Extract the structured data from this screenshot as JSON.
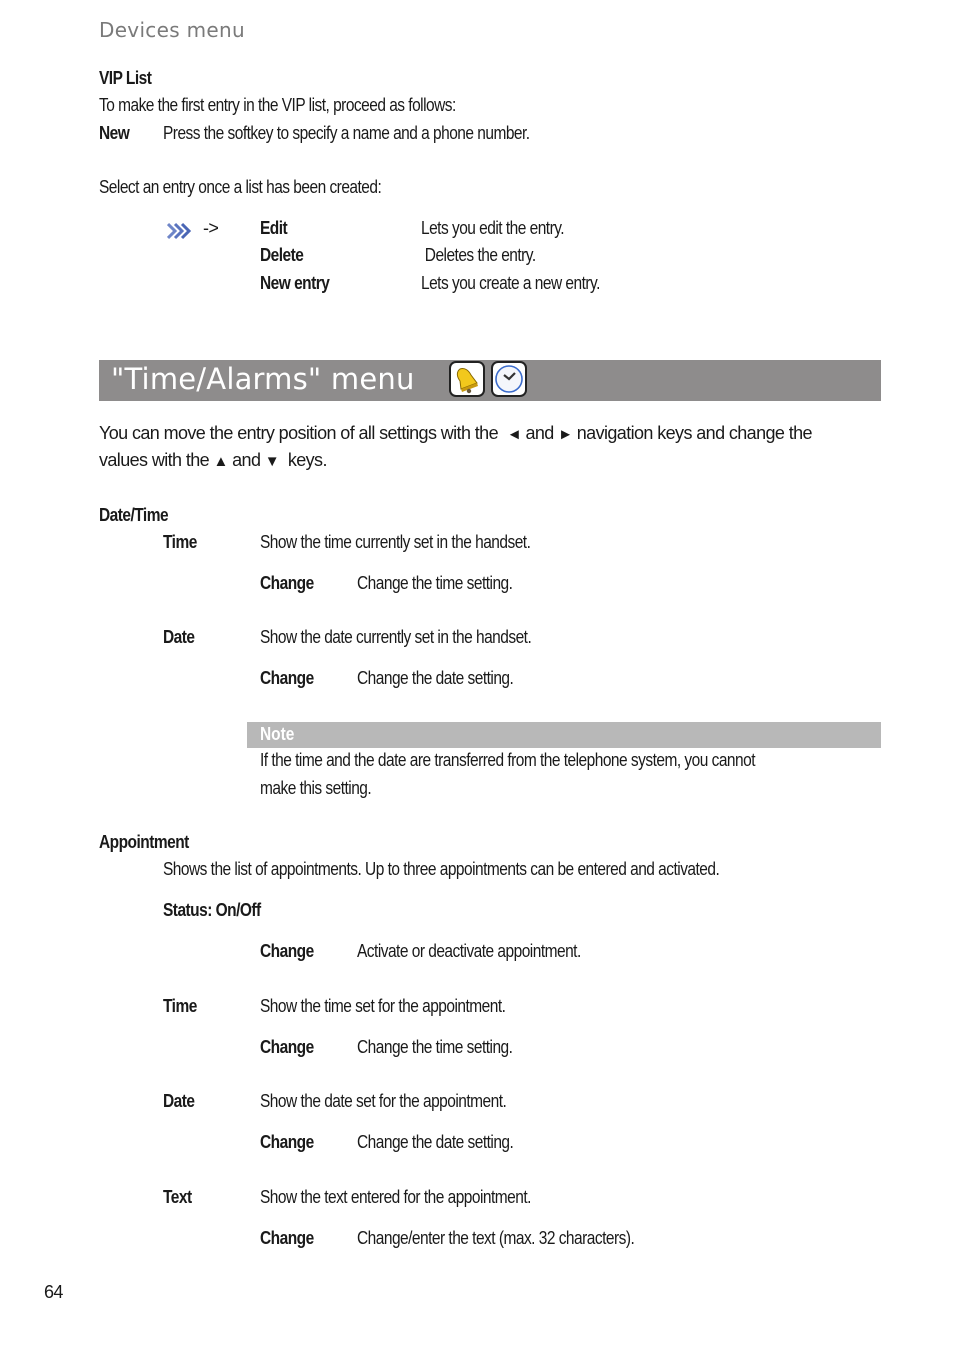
{
  "running_head": "Devices menu",
  "vip_list": {
    "heading": "VIP List",
    "intro": "To make the first entry in the VIP list, proceed as follows:",
    "new_softkey": "New",
    "new_desc": "Press the softkey to specify a name and a phone number.",
    "select_intro": "Select an entry once a list has been created:",
    "options_icon": "options-chevrons-icon",
    "arrow": "->",
    "options": [
      {
        "label": "Edit",
        "desc": "Lets you edit the entry."
      },
      {
        "label": "Delete",
        "desc": " Deletes the entry."
      },
      {
        "label": "New entry",
        "desc": "Lets you create a new entry."
      }
    ]
  },
  "section": {
    "title": "\"Time/Alarms\" menu",
    "icons": [
      "bell-icon",
      "clock-icon"
    ],
    "bar_color": "#8e8c8c"
  },
  "intro": {
    "line1_a": "You can move the entry position of all settings with the",
    "key_left": "◄",
    "and1": "and",
    "key_right": "►",
    "line1_b": "navigation keys and change the",
    "line2_a": "values with the",
    "key_up": "▲",
    "and2": "and",
    "key_down": "▼",
    "line2_b": "keys."
  },
  "date_time": {
    "heading": "Date/Time",
    "items": [
      {
        "label": "Time",
        "desc": "Show the time currently set in the handset.",
        "softkey": "Change",
        "softkey_desc": "Change the time setting."
      },
      {
        "label": "Date",
        "desc": "Show the date currently set in the handset.",
        "softkey": "Change",
        "softkey_desc": "Change the date setting."
      }
    ],
    "note": {
      "label": "Note",
      "line1": "If the time and the date are transferred from the telephone system, you cannot",
      "line2": "make this setting."
    }
  },
  "appointment": {
    "heading": "Appointment",
    "desc": "Shows the list of appointments. Up to three appointments can be entered and activated.",
    "status_label": "Status: On/Off",
    "status_softkey": "Change",
    "status_softkey_desc": "Activate or deactivate appointment.",
    "items": [
      {
        "label": "Time",
        "desc": "Show the time set for the appointment.",
        "softkey": "Change",
        "softkey_desc": "Change the time setting."
      },
      {
        "label": "Date",
        "desc": "Show the date set for the appointment.",
        "softkey": "Change",
        "softkey_desc": "Change the date setting."
      },
      {
        "label": "Text",
        "desc": "Show the text entered for the appointment.",
        "softkey": "Change",
        "softkey_desc": "Change/enter the text (max. 32 characters)."
      }
    ]
  },
  "page_number": "64"
}
